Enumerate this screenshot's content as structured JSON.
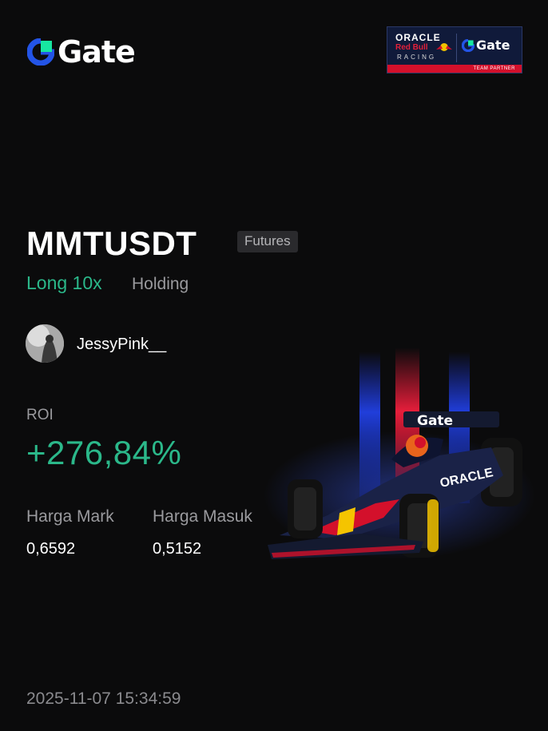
{
  "brand": {
    "logo_text": "Gate",
    "partner_badge": {
      "line1": "ORACLE",
      "line2": "Red Bull",
      "line3": "RACING",
      "logo_text": "Gate",
      "footer": "TEAM PARTNER"
    }
  },
  "position": {
    "pair": "MMTUSDT",
    "market_tag": "Futures",
    "direction": "Long 10x",
    "status": "Holding"
  },
  "user": {
    "username": "JessyPink__"
  },
  "stats": {
    "roi_label": "ROI",
    "roi_value": "+276,84%",
    "mark_price_label": "Harga Mark",
    "mark_price_value": "0,6592",
    "entry_price_label": "Harga Masuk",
    "entry_price_value": "0,5152"
  },
  "footer": {
    "timestamp": "2025-11-07 15:34:59"
  },
  "colors": {
    "background": "#0b0b0c",
    "positive": "#2bb88a",
    "muted": "#9a9a9e",
    "gate_blue": "#2354e6",
    "gate_green": "#17e6a1"
  }
}
